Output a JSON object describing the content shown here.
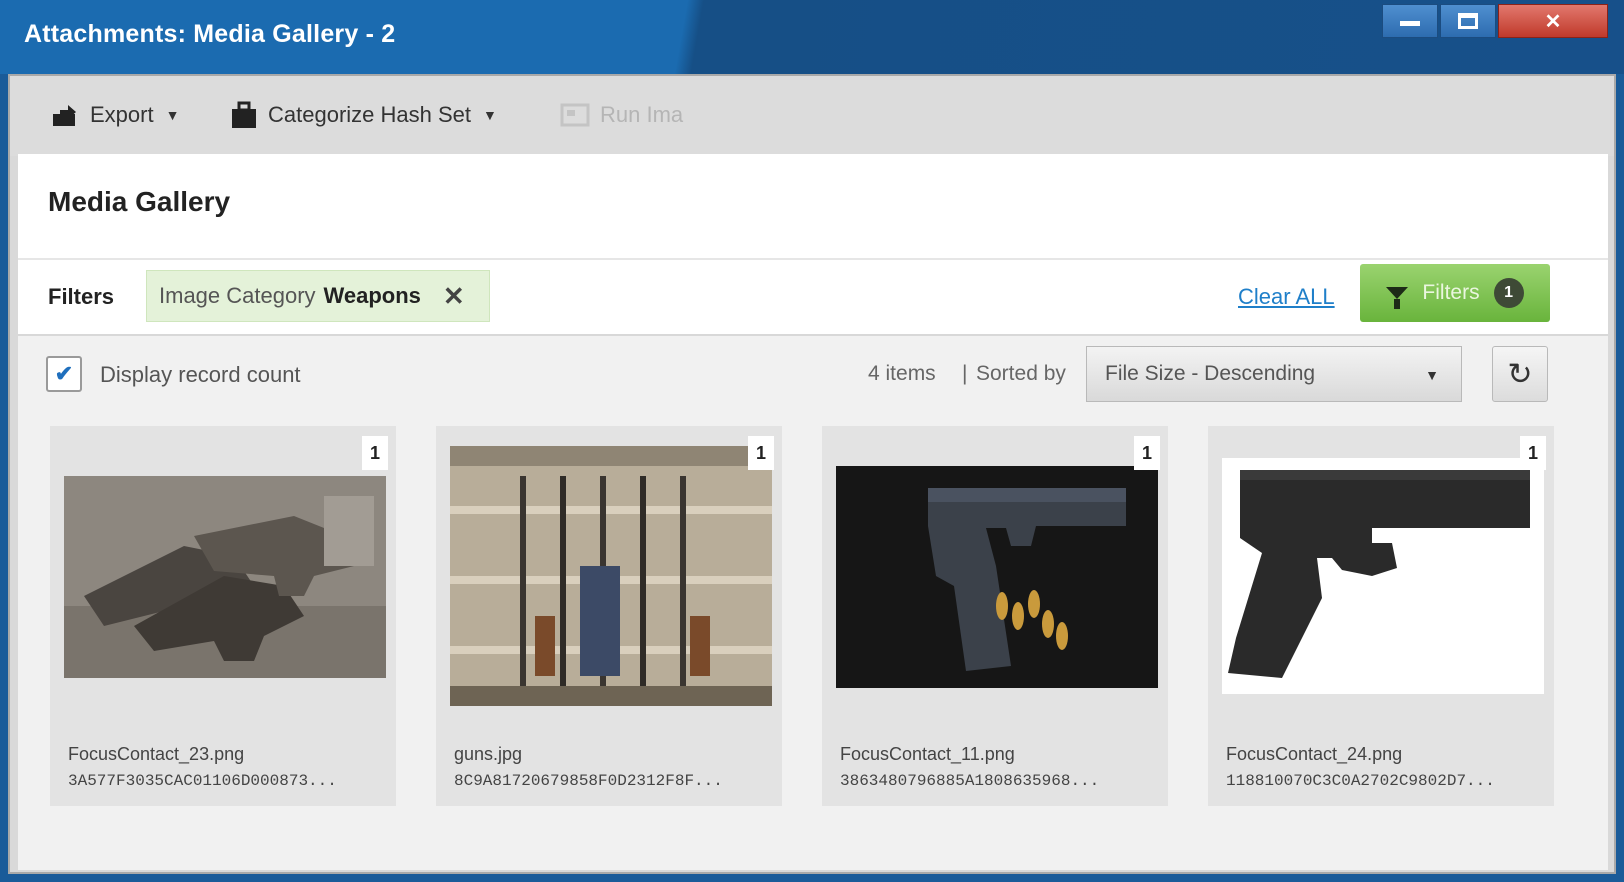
{
  "window": {
    "title": "Attachments: Media Gallery - 2",
    "controls": {
      "minimize": "minimize",
      "maximize": "maximize",
      "close": "✕"
    }
  },
  "toolbar": {
    "export_label": "Export",
    "categorize_label": "Categorize Hash Set",
    "run_label": "Run Ima"
  },
  "page": {
    "title": "Media Gallery"
  },
  "filters": {
    "label": "Filters",
    "chip": {
      "key": "Image Category",
      "value": "Weapons"
    },
    "clear_all": "Clear ALL",
    "button_label": "Filters",
    "button_count": "1"
  },
  "gallery": {
    "display_record_count_label": "Display record count",
    "display_record_count_checked": true,
    "item_count": "4 items",
    "separator": "|",
    "sorted_by_label": "Sorted by",
    "sort_value": "File Size - Descending",
    "items": [
      {
        "count": "1",
        "filename": "FocusContact_23.png",
        "hash": "3A577F3035CAC01106D000873..."
      },
      {
        "count": "1",
        "filename": "guns.jpg",
        "hash": "8C9A81720679858F0D2312F8F..."
      },
      {
        "count": "1",
        "filename": "FocusContact_11.png",
        "hash": "3863480796885A1808635968..."
      },
      {
        "count": "1",
        "filename": "FocusContact_24.png",
        "hash": "118810070C3C0A2702C9802D7..."
      }
    ]
  },
  "colors": {
    "titlebar": "#1b6bb0",
    "chip_bg": "#e4f2d9",
    "filters_button": "#69b43c",
    "link": "#1f7fc9"
  }
}
